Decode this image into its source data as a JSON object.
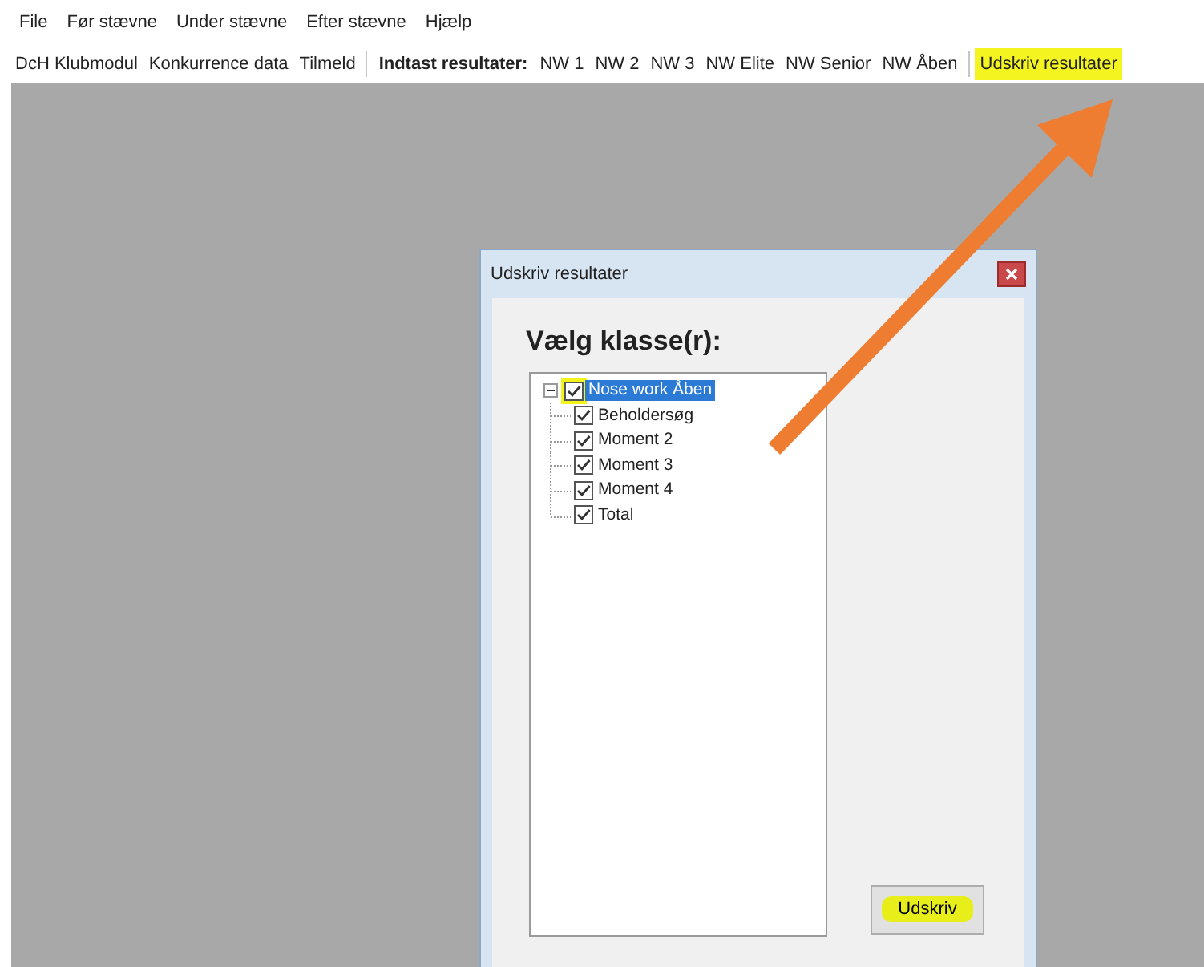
{
  "menu": [
    {
      "label": "File"
    },
    {
      "label": "Før stævne"
    },
    {
      "label": "Under stævne"
    },
    {
      "label": "Efter stævne"
    },
    {
      "label": "Hjælp"
    }
  ],
  "toolbar": [
    {
      "kind": "button",
      "label": "DcH Klubmodul",
      "highlighted": false
    },
    {
      "kind": "button",
      "label": "Konkurrence data",
      "highlighted": false
    },
    {
      "kind": "button",
      "label": "Tilmeld",
      "highlighted": false
    },
    {
      "kind": "separator"
    },
    {
      "kind": "label",
      "label": "Indtast resultater:"
    },
    {
      "kind": "button",
      "label": "NW 1",
      "highlighted": false
    },
    {
      "kind": "button",
      "label": "NW 2",
      "highlighted": false
    },
    {
      "kind": "button",
      "label": "NW 3",
      "highlighted": false
    },
    {
      "kind": "button",
      "label": "NW Elite",
      "highlighted": false
    },
    {
      "kind": "button",
      "label": "NW Senior",
      "highlighted": false
    },
    {
      "kind": "button",
      "label": "NW Åben",
      "highlighted": false
    },
    {
      "kind": "separator"
    },
    {
      "kind": "button",
      "label": "Udskriv resultater",
      "highlighted": true
    }
  ],
  "dialog": {
    "title": "Udskriv resultater",
    "heading": "Vælg klasse(r):",
    "tree": [
      {
        "label": "Nose work Åben",
        "checked": true,
        "selected": true,
        "expanded": true,
        "highlighted": true,
        "children": [
          {
            "label": "Beholdersøg",
            "checked": true,
            "selected": false,
            "highlighted": false
          },
          {
            "label": "Moment 2",
            "checked": true,
            "selected": false,
            "highlighted": false
          },
          {
            "label": "Moment 3",
            "checked": true,
            "selected": false,
            "highlighted": false
          },
          {
            "label": "Moment 4",
            "checked": true,
            "selected": false,
            "highlighted": false
          },
          {
            "label": "Total",
            "checked": true,
            "selected": false,
            "highlighted": false
          }
        ]
      }
    ],
    "button": {
      "label": "Udskriv",
      "highlighted": true
    }
  }
}
